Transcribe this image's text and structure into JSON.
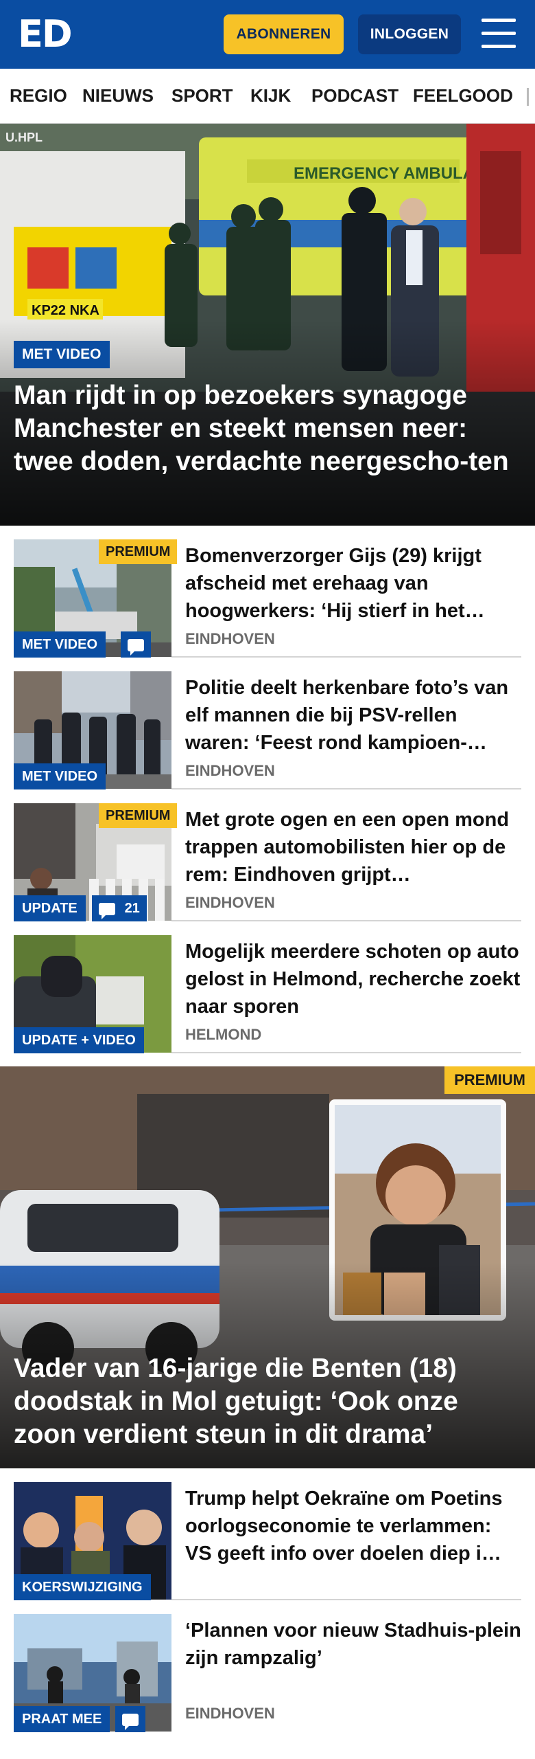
{
  "header": {
    "logo_text": "ED",
    "subscribe_label": "ABONNEREN",
    "login_label": "INLOGGEN",
    "menu_icon": "hamburger-menu-icon",
    "bg_color": "#0a4da2",
    "accent_color": "#f7c227"
  },
  "nav": {
    "items": [
      "REGIO",
      "NIEUWS",
      "SPORT",
      "KIJK",
      "PODCAST",
      "FEELGOOD"
    ]
  },
  "hero_main": {
    "badge": "MET VIDEO",
    "title": "Man rijdt in op bezoekers synagoge Manchester en steekt mensen neer: twee doden, verdachte neergescho-ten",
    "image_text_plate": "KP22 NKA",
    "image_text_ambulance": "EMERGENCY AMBULA",
    "image_text_top": "U.HPL"
  },
  "articles": [
    {
      "premium": "PREMIUM",
      "badge": "MET VIDEO",
      "title": "Bomenverzorger Gijs (29) krijgt afscheid met erehaag van hoogwerkers: ‘Hij stierf in het…",
      "location": "EINDHOVEN"
    },
    {
      "badge": "MET VIDEO",
      "title": "Politie deelt herkenbare foto’s van elf mannen die bij PSV-rellen waren: ‘Feest rond kampioen-…",
      "location": "EINDHOVEN"
    },
    {
      "premium": "PREMIUM",
      "badge": "UPDATE",
      "comments": "21",
      "title": "Met grote ogen en een open mond trappen automobilisten hier op de rem: Eindhoven grijpt…",
      "location": "EINDHOVEN"
    },
    {
      "badge": "UPDATE + VIDEO",
      "title": "Mogelijk meerdere schoten op auto gelost in Helmond, recherche zoekt naar sporen",
      "location": "HELMOND"
    }
  ],
  "hero_second": {
    "premium": "PREMIUM",
    "title": "Vader van 16-jarige die Benten (18) doodstak in Mol getuigt: ‘Ook onze zoon verdient steun in dit drama’"
  },
  "articles_bottom": [
    {
      "badge": "KOERSWIJZIGING",
      "title": "Trump helpt Oekraïne om Poetins oorlogseconomie te verlammen: VS geeft info over doelen diep i…",
      "location": ""
    },
    {
      "badge": "PRAAT MEE",
      "title": "‘Plannen voor nieuw Stadhuis-plein zijn rampzalig’",
      "location": "EINDHOVEN"
    }
  ]
}
